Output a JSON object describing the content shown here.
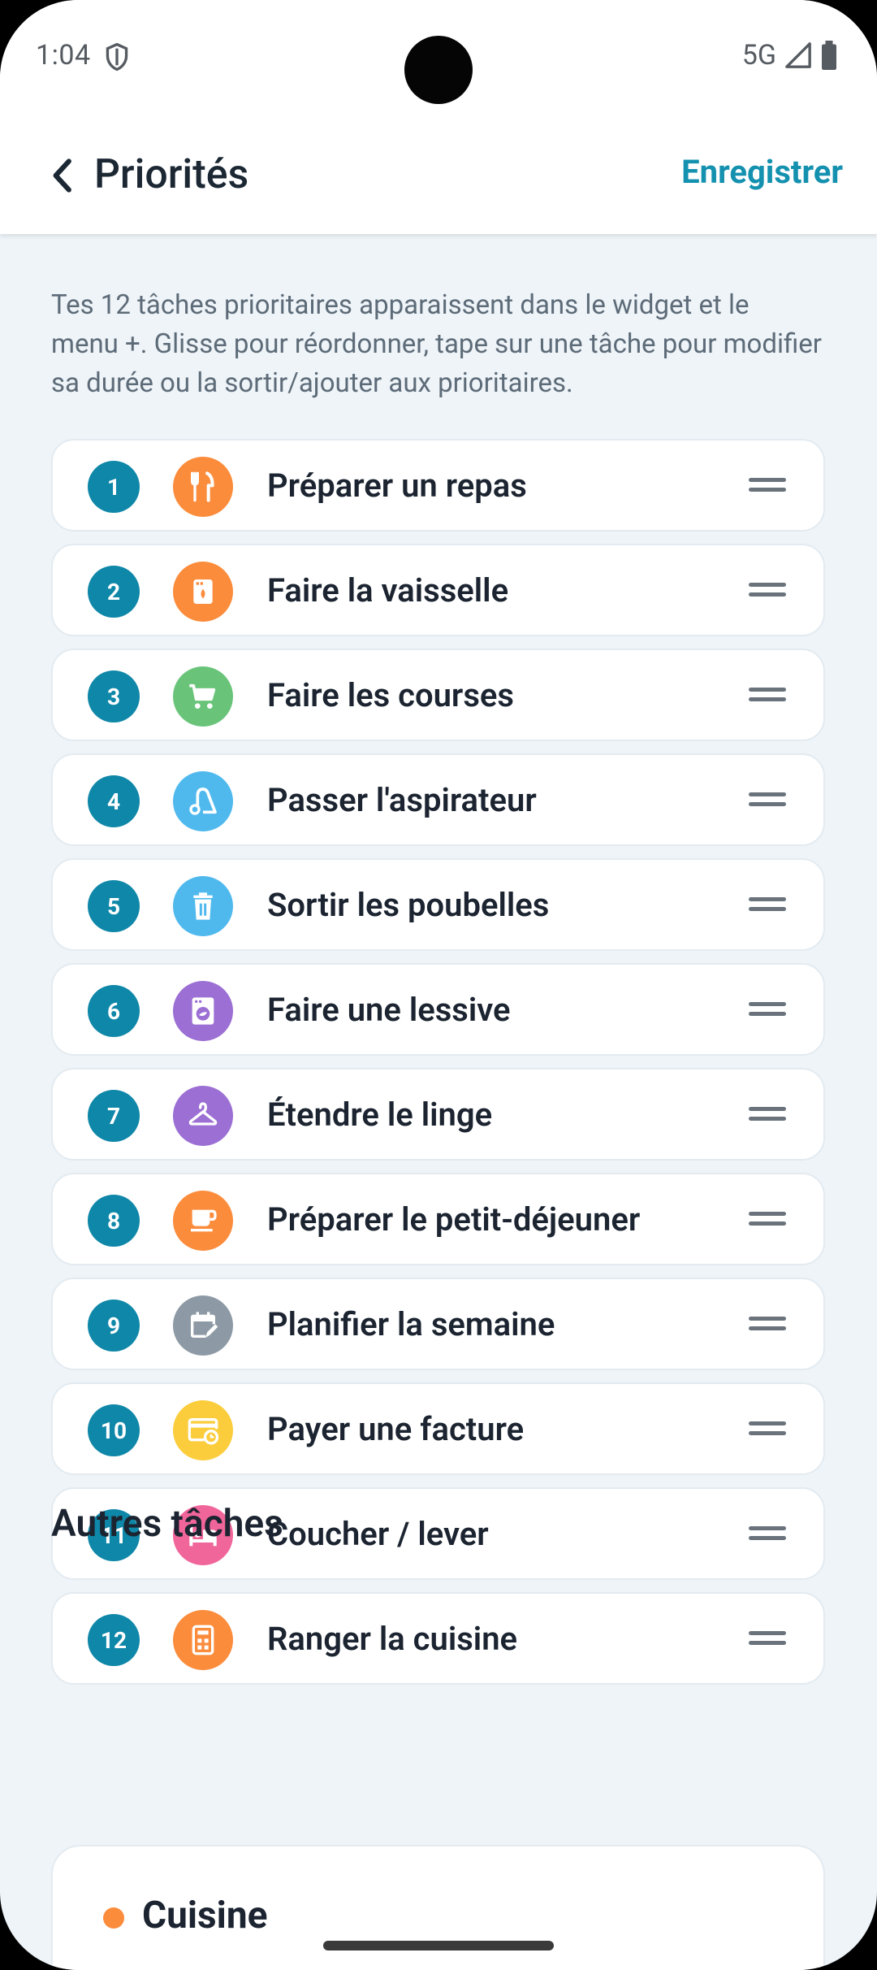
{
  "status": {
    "time": "1:04",
    "network": "5G"
  },
  "header": {
    "title": "Priorités",
    "save_label": "Enregistrer"
  },
  "intro": "Tes 12 tâches prioritaires apparaissent dans le widget et le menu +. Glisse pour réordonner, tape sur une tâche pour modifier sa durée ou la sortir/ajouter aux prioritaires.",
  "tasks": [
    {
      "num": "1",
      "label": "Préparer un repas",
      "icon": "restaurant-icon",
      "color": "#fb8c3c"
    },
    {
      "num": "2",
      "label": "Faire la vaisselle",
      "icon": "dishwasher-icon",
      "color": "#fb8c3c"
    },
    {
      "num": "3",
      "label": "Faire les courses",
      "icon": "shopping-cart-icon",
      "color": "#69c47a"
    },
    {
      "num": "4",
      "label": "Passer l'aspirateur",
      "icon": "vacuum-icon",
      "color": "#4fb9ee"
    },
    {
      "num": "5",
      "label": "Sortir les poubelles",
      "icon": "trash-icon",
      "color": "#4fb9ee"
    },
    {
      "num": "6",
      "label": "Faire une lessive",
      "icon": "washing-machine-icon",
      "color": "#9b6fd3"
    },
    {
      "num": "7",
      "label": "Étendre le linge",
      "icon": "hanger-icon",
      "color": "#9b6fd3"
    },
    {
      "num": "8",
      "label": "Préparer le petit-déjeuner",
      "icon": "coffee-cup-icon",
      "color": "#fb8c3c"
    },
    {
      "num": "9",
      "label": "Planifier la semaine",
      "icon": "calendar-edit-icon",
      "color": "#8d9aa5"
    },
    {
      "num": "10",
      "label": "Payer une facture",
      "icon": "bill-icon",
      "color": "#fbcd3c"
    },
    {
      "num": "11",
      "label": "Coucher / lever",
      "icon": "bed-icon",
      "color": "#f0659a"
    },
    {
      "num": "12",
      "label": "Ranger la cuisine",
      "icon": "kitchen-icon",
      "color": "#fb8c3c"
    }
  ],
  "other": {
    "title": "Autres tâches",
    "categories": [
      {
        "label": "Cuisine",
        "color": "#fb8c3c"
      }
    ]
  }
}
